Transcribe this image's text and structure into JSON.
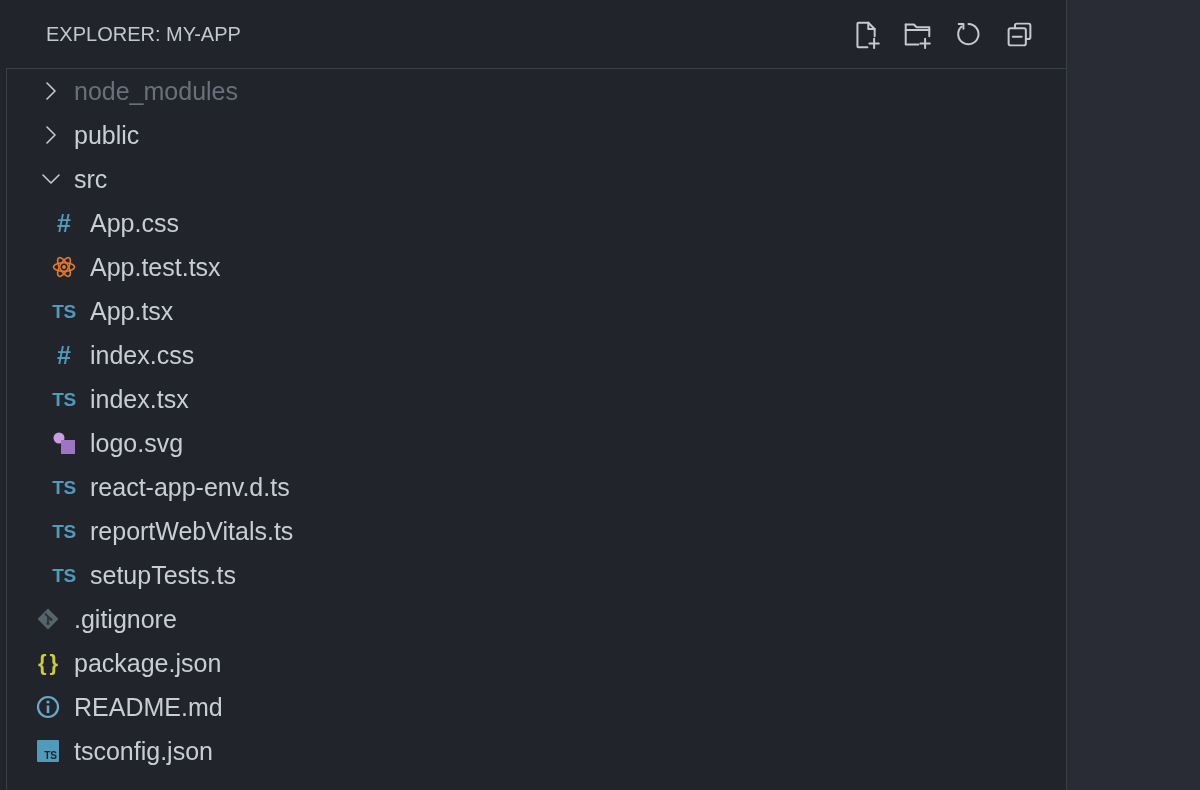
{
  "explorer": {
    "title": "EXPLORER: MY-APP"
  },
  "tree": [
    {
      "name": "node_modules",
      "kind": "folder",
      "expanded": false,
      "ignored": true
    },
    {
      "name": "public",
      "kind": "folder",
      "expanded": false,
      "ignored": false
    },
    {
      "name": "src",
      "kind": "folder",
      "expanded": true,
      "ignored": false,
      "children": [
        {
          "name": "App.css",
          "kind": "css",
          "glyph": "#",
          "ignored": false
        },
        {
          "name": "App.test.tsx",
          "kind": "react",
          "ignored": false
        },
        {
          "name": "App.tsx",
          "kind": "ts",
          "glyph": "TS",
          "ignored": false
        },
        {
          "name": "index.css",
          "kind": "css",
          "glyph": "#",
          "ignored": false
        },
        {
          "name": "index.tsx",
          "kind": "ts",
          "glyph": "TS",
          "ignored": false
        },
        {
          "name": "logo.svg",
          "kind": "image",
          "ignored": false
        },
        {
          "name": "react-app-env.d.ts",
          "kind": "ts",
          "glyph": "TS",
          "ignored": false
        },
        {
          "name": "reportWebVitals.ts",
          "kind": "ts",
          "glyph": "TS",
          "ignored": false
        },
        {
          "name": "setupTests.ts",
          "kind": "ts",
          "glyph": "TS",
          "ignored": false
        }
      ]
    },
    {
      "name": ".gitignore",
      "kind": "git",
      "ignored": false
    },
    {
      "name": "package.json",
      "kind": "json",
      "glyph": "{}",
      "ignored": false
    },
    {
      "name": "README.md",
      "kind": "info",
      "ignored": false
    },
    {
      "name": "tsconfig.json",
      "kind": "tsconfig",
      "glyph": "TS",
      "ignored": false
    }
  ]
}
